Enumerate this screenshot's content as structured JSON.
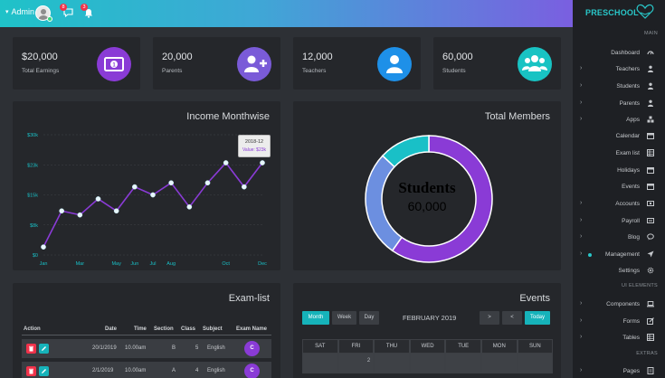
{
  "topbar": {
    "user_label": "Admin",
    "messages_badge": "8",
    "notifications_badge": "3"
  },
  "sidebar": {
    "brand": "PRESCHOOL",
    "sections": {
      "main": "MAIN",
      "ui_elements": "UI ELEMENTS",
      "extras": "EXTRAS"
    },
    "items": [
      {
        "label": "Dashboard",
        "icon": "dashboard-icon",
        "chevron": false
      },
      {
        "label": "Teachers",
        "icon": "user-icon",
        "chevron": true
      },
      {
        "label": "Students",
        "icon": "user-icon",
        "chevron": true
      },
      {
        "label": "Parents",
        "icon": "user-icon",
        "chevron": true
      },
      {
        "label": "Apps",
        "icon": "cubes-icon",
        "chevron": true
      },
      {
        "label": "Calendar",
        "icon": "calendar-icon",
        "chevron": false
      },
      {
        "label": "Exam list",
        "icon": "table-icon",
        "chevron": false
      },
      {
        "label": "Holidays",
        "icon": "calendar-icon",
        "chevron": false
      },
      {
        "label": "Events",
        "icon": "calendar-icon",
        "chevron": false
      },
      {
        "label": "Accounts",
        "icon": "money-icon",
        "chevron": true
      },
      {
        "label": "Payroll",
        "icon": "payroll-icon",
        "chevron": true
      },
      {
        "label": "Blog",
        "icon": "comment-icon",
        "chevron": true
      },
      {
        "label": "Management",
        "icon": "send-icon",
        "chevron": true,
        "active_dot": true
      },
      {
        "label": "Settings",
        "icon": "gear-icon",
        "chevron": false
      },
      {
        "label": "Components",
        "icon": "laptop-icon",
        "chevron": true
      },
      {
        "label": "Forms",
        "icon": "edit-icon",
        "chevron": true
      },
      {
        "label": "Tables",
        "icon": "table-icon",
        "chevron": true
      },
      {
        "label": "Pages",
        "icon": "pages-icon",
        "chevron": true
      }
    ]
  },
  "stats": [
    {
      "value": "$20,000",
      "label": "Total Earnings",
      "icon": "money-icon",
      "color": "#8a3bd6"
    },
    {
      "value": "20,000",
      "label": "Parents",
      "icon": "user-plus-icon",
      "color": "#7a5bd8"
    },
    {
      "value": "12,000",
      "label": "Teachers",
      "icon": "user-icon",
      "color": "#1e90e8"
    },
    {
      "value": "60,000",
      "label": "Students",
      "icon": "users-icon",
      "color": "#18c3c3"
    }
  ],
  "income_panel": {
    "title": "Income Monthwise",
    "tooltip": {
      "title": "2018-12",
      "value": "Value: $23k"
    }
  },
  "members_panel": {
    "title": "Total Members",
    "center_label": "Students",
    "center_value": "60,000"
  },
  "chart_data": [
    {
      "type": "line",
      "title": "Income Monthwise",
      "x": [
        "Jan",
        "",
        "Mar",
        "",
        "May",
        "Jun",
        "Jul",
        "Aug",
        "",
        "",
        "Oct",
        "",
        "Dec"
      ],
      "x_tick_labels": [
        "Jan",
        "Mar",
        "May",
        "Jun",
        "Jul",
        "Aug",
        "Oct",
        "Dec"
      ],
      "y_tick_labels": [
        "$0",
        "$8k",
        "$15k",
        "$23k",
        "$30k"
      ],
      "ylim": [
        0,
        30
      ],
      "values": [
        2,
        11,
        10,
        14,
        11,
        17,
        15,
        18,
        12,
        18,
        23,
        17,
        23
      ],
      "color": "#8a3bd6",
      "grid": true
    },
    {
      "type": "pie",
      "title": "Total Members",
      "donut": true,
      "slices": [
        {
          "value": 55,
          "color": "#8a3bd6"
        },
        {
          "value": 25,
          "color": "#6c8fe0"
        },
        {
          "value": 12,
          "color": "#19c0c7"
        }
      ]
    }
  ],
  "exam_panel": {
    "title": "Exam-list",
    "columns": [
      "Action",
      "Date",
      "Time",
      "Section",
      "Class",
      "Subject",
      "Exam Name"
    ],
    "rows": [
      {
        "date": "20/1/2019",
        "time": "10.00am",
        "section": "B",
        "class": "5",
        "subject": "English",
        "exam": "C"
      },
      {
        "date": "2/1/2019",
        "time": "10.00am",
        "section": "A",
        "class": "4",
        "subject": "English",
        "exam": "C"
      }
    ]
  },
  "events_panel": {
    "title": "Events",
    "views": [
      "Month",
      "Week",
      "Day"
    ],
    "month_label": "FEBRUARY 2019",
    "today_label": "Today",
    "prev_label": "<",
    "next_label": ">",
    "weekdays": [
      "SAT",
      "FRI",
      "THU",
      "WED",
      "TUE",
      "MON",
      "SUN"
    ],
    "first_row_dates": [
      "",
      "2",
      "",
      "",
      "",
      "",
      ""
    ]
  }
}
